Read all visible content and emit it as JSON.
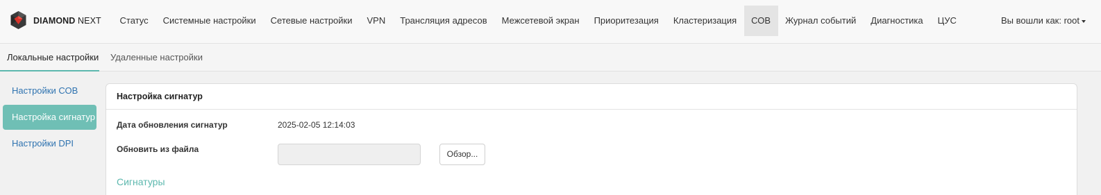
{
  "brand": {
    "name_bold": "DIAMOND",
    "name_light": "NEXT",
    "icon": "diamond-logo-icon"
  },
  "nav": {
    "items": [
      {
        "label": "Статус"
      },
      {
        "label": "Системные настройки"
      },
      {
        "label": "Сетевые настройки"
      },
      {
        "label": "VPN"
      },
      {
        "label": "Трансляция адресов"
      },
      {
        "label": "Межсетевой экран"
      },
      {
        "label": "Приоритезация"
      },
      {
        "label": "Кластеризация"
      },
      {
        "label": "СОВ"
      },
      {
        "label": "Журнал событий"
      },
      {
        "label": "Диагностика"
      },
      {
        "label": "ЦУС"
      }
    ],
    "active": "СОВ"
  },
  "user": {
    "label": "Вы вошли как: root",
    "icon": "caret-down-icon"
  },
  "subtabs": [
    {
      "label": "Локальные настройки"
    },
    {
      "label": "Удаленные настройки"
    }
  ],
  "sidebar": {
    "items": [
      {
        "label": "Настройки СОВ"
      },
      {
        "label": "Настройка сигнатур"
      },
      {
        "label": "Настройки DPI"
      }
    ],
    "active": "Настройка сигнатур"
  },
  "panel": {
    "title": "Настройка сигнатур",
    "update_date_label": "Дата обновления сигнатур",
    "update_date_value": "2025-02-05 12:14:03",
    "file_label": "Обновить из файла",
    "file_value": "",
    "browse_label": "Обзор...",
    "section_title": "Сигнатуры"
  },
  "colors": {
    "accent": "#5cb8ae",
    "active_sidebar_bg": "#6fbfb5",
    "link": "#2f73b0",
    "logo_red": "#d9342b"
  }
}
